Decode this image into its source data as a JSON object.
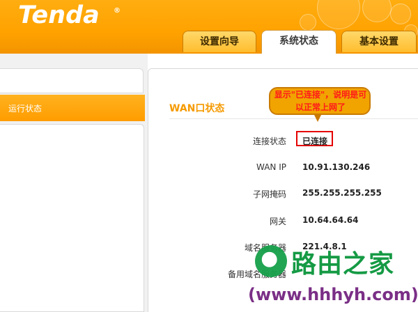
{
  "header": {
    "logo": "Tenda",
    "logo_mark": "®",
    "tabs": [
      {
        "label": "设置向导",
        "active": false
      },
      {
        "label": "系统状态",
        "active": true
      },
      {
        "label": "基本设置",
        "active": false
      }
    ]
  },
  "sidebar": {
    "items": [
      {
        "label": "运行状态",
        "selected": true
      }
    ]
  },
  "main": {
    "section_title": "WAN口状态",
    "rows": [
      {
        "label": "连接状态",
        "value": "已连接"
      },
      {
        "label": "WAN IP",
        "value": "10.91.130.246"
      },
      {
        "label": "子网掩码",
        "value": "255.255.255.255"
      },
      {
        "label": "网关",
        "value": "10.64.64.64"
      },
      {
        "label": "域名服务器",
        "value": "221.4.8.1"
      },
      {
        "label": "备用域名服务器",
        "value": ""
      }
    ]
  },
  "annotation": {
    "text": "显示\"已连接\"，说明是可以正常上网了"
  },
  "watermark": {
    "brand": "路由之家",
    "url": "(www.hhhyh.com)"
  },
  "colors": {
    "header_orange": "#ffa200",
    "accent_orange": "#f59a00",
    "highlight_red": "#e50000",
    "watermark_green": "#159a44",
    "watermark_purple": "#7a2f86"
  }
}
